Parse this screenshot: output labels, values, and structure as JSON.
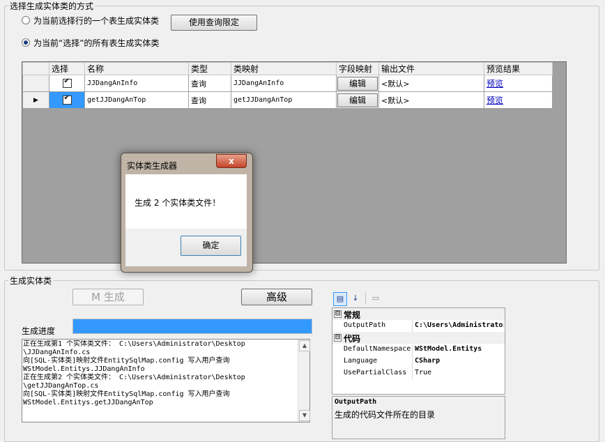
{
  "mode_group": {
    "title": "选择生成实体类的方式",
    "option_single": "为当前选择行的一个表生成实体类",
    "option_all": "为当前“选择”的所有表生成实体类",
    "query_limit_button": "使用查询限定"
  },
  "grid": {
    "columns": [
      "选择",
      "名称",
      "类型",
      "类映射",
      "字段映射",
      "输出文件",
      "预览结果"
    ],
    "rows": [
      {
        "checked": true,
        "name": "JJDangAnInfo",
        "type": "查询",
        "mapping": "JJDangAnInfo",
        "field_button": "编辑",
        "output": "<默认>",
        "preview": "预览",
        "current": false
      },
      {
        "checked": true,
        "name": "getJJDangAnTop",
        "type": "查询",
        "mapping": "getJJDangAnTop",
        "field_button": "编辑",
        "output": "<默认>",
        "preview": "预览",
        "current": true
      }
    ]
  },
  "dialog": {
    "title": "实体类生成器",
    "close": "x",
    "message": "生成 2 个实体类文件！",
    "ok_button": "确定"
  },
  "generate_group": {
    "title": "生成实体类",
    "generate_button": "M 生成",
    "advanced_button": "高级",
    "progress_label": "生成进度",
    "progress_value": 1.0,
    "log_lines": [
      "正在生成第1 个实体类文件： C:\\Users\\Administrator\\Desktop",
      "\\JJDangAnInfo.cs",
      "向[SQL-实体类]映射文件EntitySqlMap.config 写入用户查询",
      "WStModel.Entitys.JJDangAnInfo",
      "正在生成第2 个实体类文件： C:\\Users\\Administrator\\Desktop",
      "\\getJJDangAnTop.cs",
      "向[SQL-实体类]映射文件EntitySqlMap.config 写入用户查询",
      "WStModel.Entitys.getJJDangAnTop"
    ]
  },
  "property_grid": {
    "toolbar_icons": [
      "categorized-icon",
      "alphabetical-icon",
      "property-pages-icon"
    ],
    "categories": [
      {
        "name": "常规",
        "expand": "⊟",
        "props": [
          {
            "name": "OutputPath",
            "value": "C:\\Users\\Administrator\\Desktop"
          }
        ]
      },
      {
        "name": "代码",
        "expand": "⊟",
        "props": [
          {
            "name": "DefaultNamespace",
            "value": "WStModel.Entitys"
          },
          {
            "name": "Language",
            "value": "CSharp"
          },
          {
            "name": "UsePartialClass",
            "value": "True"
          }
        ]
      }
    ],
    "help_title": "OutputPath",
    "help_text": "生成的代码文件所在的目录"
  },
  "colors": {
    "selection": "#3399ff",
    "grid_background": "#a0a0a0",
    "dialog_frame": "#bfb4a6",
    "link": "#0000c0"
  }
}
